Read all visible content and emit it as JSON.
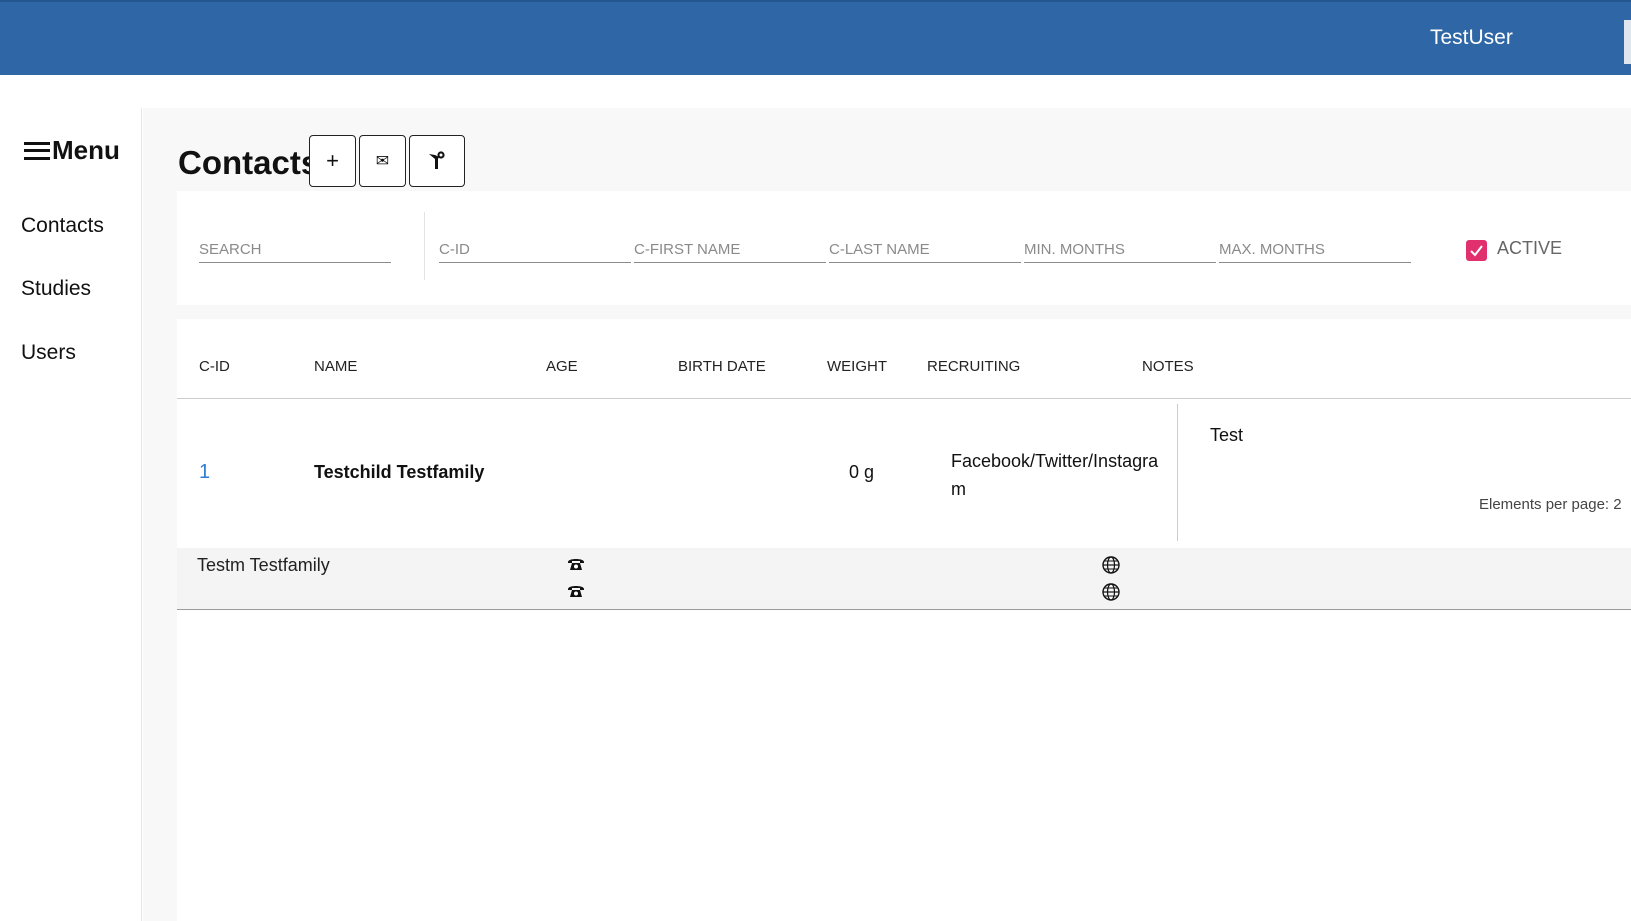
{
  "header": {
    "user_name": "TestUser"
  },
  "sidebar": {
    "menu_label": "Menu",
    "items": [
      {
        "label": "Contacts"
      },
      {
        "label": "Studies"
      },
      {
        "label": "Users"
      }
    ]
  },
  "main": {
    "title": "Contacts",
    "toolbar": {
      "add_label": "+",
      "mail_label": "✉"
    },
    "filters": {
      "search_placeholder": "SEARCH",
      "cid_placeholder": "C-ID",
      "first_name_placeholder": "C-FIRST NAME",
      "last_name_placeholder": "C-LAST NAME",
      "min_months_placeholder": "MIN. MONTHS",
      "max_months_placeholder": "MAX. MONTHS",
      "active_label": "ACTIVE",
      "active_checked": true
    },
    "table": {
      "columns": [
        "C-ID",
        "NAME",
        "AGE",
        "BIRTH DATE",
        "WEIGHT",
        "RECRUITING",
        "NOTES"
      ],
      "rows": [
        {
          "cid": "1",
          "name": "Testchild Testfamily",
          "age": "",
          "birth_date": "",
          "weight": "0 g",
          "recruiting": "Facebook/Twitter/Instagram",
          "notes": "Test",
          "parent": {
            "name": "Testm Testfamily",
            "phone_icons": [
              "phone-icon",
              "phone-icon"
            ],
            "web_icons": [
              "globe-icon",
              "globe-icon"
            ]
          }
        }
      ],
      "elements_per_page_label": "Elements per page: 2"
    }
  },
  "colors": {
    "header_bg": "#2f66a5",
    "link": "#2f7cd6",
    "checkbox": "#e0306e"
  }
}
